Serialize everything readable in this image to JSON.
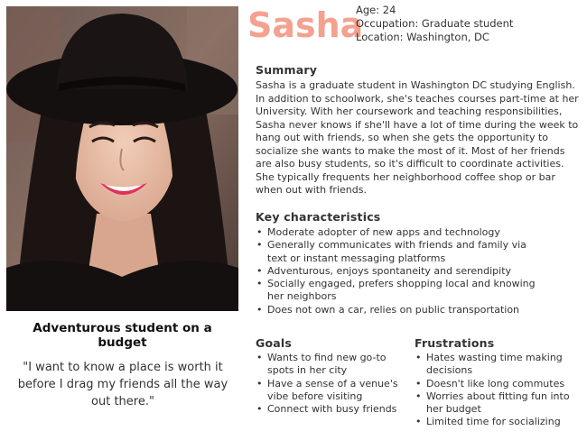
{
  "persona": {
    "name": "Sasha",
    "age": "Age: 24",
    "occupation": "Occupation: Graduate student",
    "location": "Location: Washington, DC",
    "tagline": "Adventurous  student on a budget",
    "quote": "\"I want to know a place is worth it before I drag my friends all the way out there.\""
  },
  "summary": {
    "title": "Summary",
    "text": "Sasha is a graduate student in Washington DC studying English. In addition to schoolwork, she's teaches courses part-time at her University. With her coursework and teaching responsibilities, Sasha never knows if she'll have a lot of time during the week to hang out with friends, so when she gets the opportunity to socialize she wants to make the most of it. Most of her friends are also busy students, so it's difficult to coordinate activities. She typically frequents her neighborhood coffee shop or bar when out with friends."
  },
  "characteristics": {
    "title": "Key characteristics",
    "items": [
      "Moderate adopter of new apps and technology",
      "Generally communicates with friends and family via text or instant messaging platforms",
      "Adventurous, enjoys spontaneity and serendipity",
      "Socially engaged, prefers shopping local and knowing her neighbors",
      "Does not own a car, relies on public transportation"
    ]
  },
  "goals": {
    "title": "Goals",
    "items": [
      "Wants to find new go-to spots in her city",
      "Have a sense of a venue's vibe before visiting",
      "Connect with busy friends"
    ]
  },
  "frustrations": {
    "title": "Frustrations",
    "items": [
      "Hates wasting time making decisions",
      "Doesn't like long commutes",
      "Worries about fitting fun into her budget",
      "Limited time for socializing"
    ]
  },
  "colors": {
    "name_accent": "#f4a18f",
    "text": "#333333"
  }
}
